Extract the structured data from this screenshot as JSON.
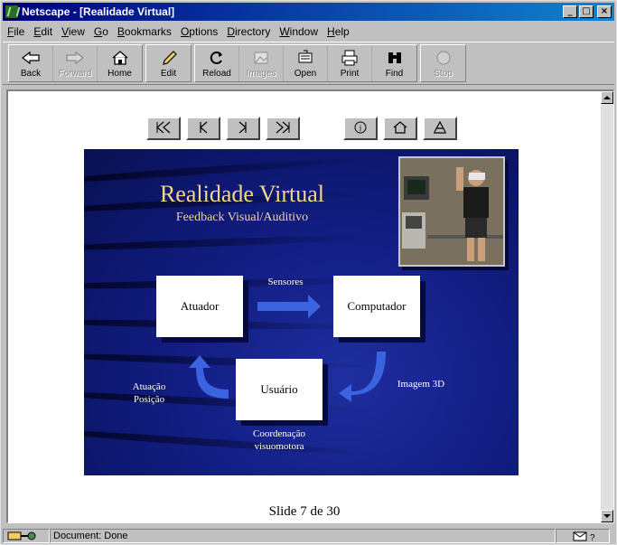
{
  "window": {
    "title": "Netscape - [Realidade Virtual]",
    "controls": [
      "minimize",
      "maximize",
      "close"
    ]
  },
  "menu": [
    {
      "label": "File",
      "key": "F",
      "rest": "ile"
    },
    {
      "label": "Edit",
      "key": "E",
      "rest": "dit"
    },
    {
      "label": "View",
      "key": "V",
      "rest": "iew"
    },
    {
      "label": "Go",
      "key": "G",
      "rest": "o"
    },
    {
      "label": "Bookmarks",
      "key": "B",
      "rest": "ookmarks"
    },
    {
      "label": "Options",
      "key": "O",
      "rest": "ptions"
    },
    {
      "label": "Directory",
      "key": "D",
      "rest": "irectory"
    },
    {
      "label": "Window",
      "key": "W",
      "rest": "indow"
    },
    {
      "label": "Help",
      "key": "H",
      "rest": "elp"
    }
  ],
  "toolbar": {
    "back": {
      "label": "Back",
      "icon": "back-arrow-icon",
      "enabled": true
    },
    "forward": {
      "label": "Forward",
      "icon": "forward-arrow-icon",
      "enabled": false
    },
    "home": {
      "label": "Home",
      "icon": "home-icon",
      "enabled": true
    },
    "edit": {
      "label": "Edit",
      "icon": "pencil-icon",
      "enabled": true
    },
    "reload": {
      "label": "Reload",
      "icon": "reload-icon",
      "enabled": true
    },
    "images": {
      "label": "Images",
      "icon": "images-icon",
      "enabled": false
    },
    "open": {
      "label": "Open",
      "icon": "open-icon",
      "enabled": true
    },
    "print": {
      "label": "Print",
      "icon": "printer-icon",
      "enabled": true
    },
    "find": {
      "label": "Find",
      "icon": "binoculars-icon",
      "enabled": true
    },
    "stop": {
      "label": "Stop",
      "icon": "stop-icon",
      "enabled": false
    }
  },
  "slide_nav": [
    "first-slide",
    "previous-slide",
    "next-slide",
    "last-slide",
    "info",
    "index-home",
    "text-version"
  ],
  "slide": {
    "title": "Realidade Virtual",
    "subtitle": "Feedback Visual/Auditivo",
    "boxes": {
      "atuador": "Atuador",
      "computador": "Computador",
      "usuario": "Usuário"
    },
    "labels": {
      "sensores": "Sensores",
      "imagem": "Imagem 3D",
      "atuacao_line1": "Atuação",
      "atuacao_line2": "Posição",
      "coordenacao_line1": "Coordenação",
      "coordenacao_line2": "visuomotora"
    },
    "colors": {
      "background": "#131f86",
      "title": "#f2d68a",
      "arrow": "#3a63e0"
    }
  },
  "counter": "Slide 7 de 30",
  "status": {
    "text": "Document: Done"
  }
}
